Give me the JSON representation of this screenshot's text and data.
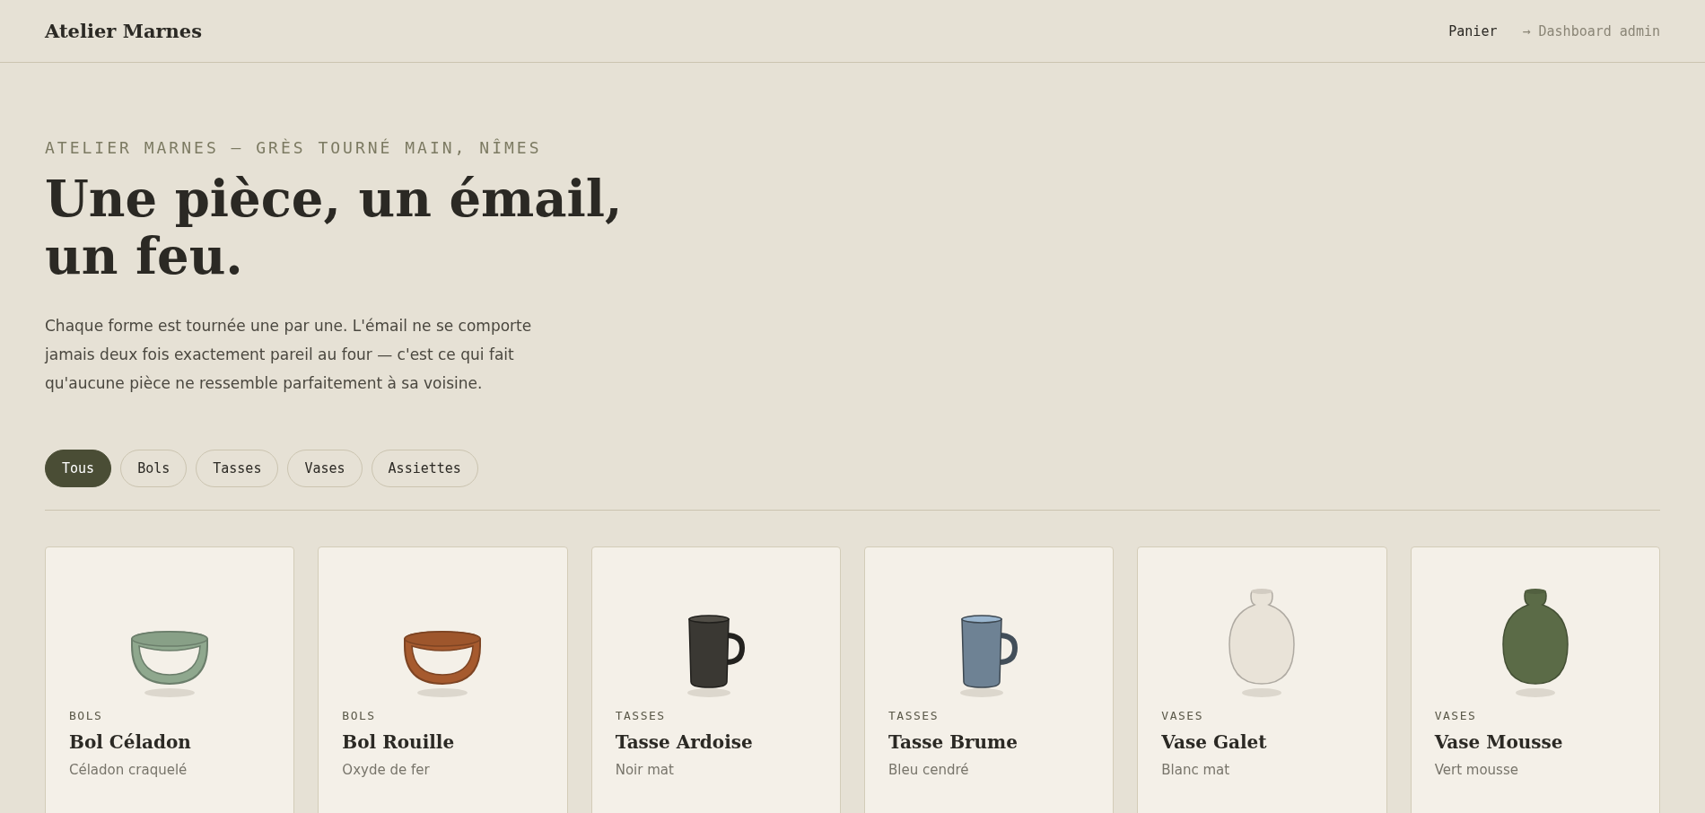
{
  "header": {
    "logo": "Atelier Marnes",
    "nav": [
      {
        "label": "Panier",
        "kind": "link"
      },
      {
        "label": "→ Dashboard admin",
        "kind": "muted"
      }
    ]
  },
  "hero": {
    "eyebrow": "ATELIER MARNES — GRÈS TOURNÉ MAIN, NÎMES",
    "title": "Une pièce, un émail, un feu.",
    "text": "Chaque forme est tournée une par une. L'émail ne se comporte jamais deux fois exactement pareil au four — c'est ce qui fait qu'aucune pièce ne ressemble parfaitement à sa voisine."
  },
  "filters": [
    {
      "label": "Tous",
      "selected": true
    },
    {
      "label": "Bols",
      "selected": false
    },
    {
      "label": "Tasses",
      "selected": false
    },
    {
      "label": "Vases",
      "selected": false
    },
    {
      "label": "Assiettes",
      "selected": false
    }
  ],
  "products": [
    {
      "kind": "bowl",
      "color": "#8fa88e",
      "category": "BOLS",
      "name": "Bol Céladon",
      "glaze": "Céladon craquelé"
    },
    {
      "kind": "bowl",
      "color": "#a65a2e",
      "category": "BOLS",
      "name": "Bol Rouille",
      "glaze": "Oxyde de fer"
    },
    {
      "kind": "mug",
      "color": "#3a3833",
      "category": "TASSES",
      "name": "Tasse Ardoise",
      "glaze": "Noir mat"
    },
    {
      "kind": "mug",
      "color": "#6e8294",
      "category": "TASSES",
      "name": "Tasse Brume",
      "glaze": "Bleu cendré"
    },
    {
      "kind": "vase",
      "color": "#e9e3d8",
      "category": "VASES",
      "name": "Vase Galet",
      "glaze": "Blanc mat"
    },
    {
      "kind": "vase",
      "color": "#5b6b47",
      "category": "VASES",
      "name": "Vase Mousse",
      "glaze": "Vert mousse"
    }
  ]
}
